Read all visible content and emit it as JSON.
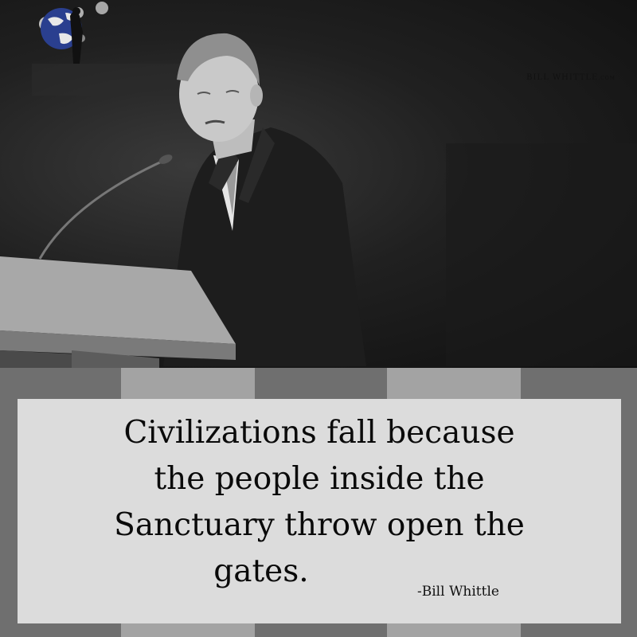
{
  "logo": {
    "text": "BILL WHITTLE",
    "suffix": ".COM"
  },
  "quote": {
    "lines": [
      "Civilizations fall because",
      "the people inside the",
      "Sanctuary throw open the",
      "gates."
    ],
    "attribution": "-Bill Whittle"
  },
  "colors": {
    "quote_box": "#dcdcdc",
    "stripe_light": "#a3a3a3",
    "stripe_dark": "#6f6f6f",
    "globe_blue": "#2a3f8f"
  }
}
